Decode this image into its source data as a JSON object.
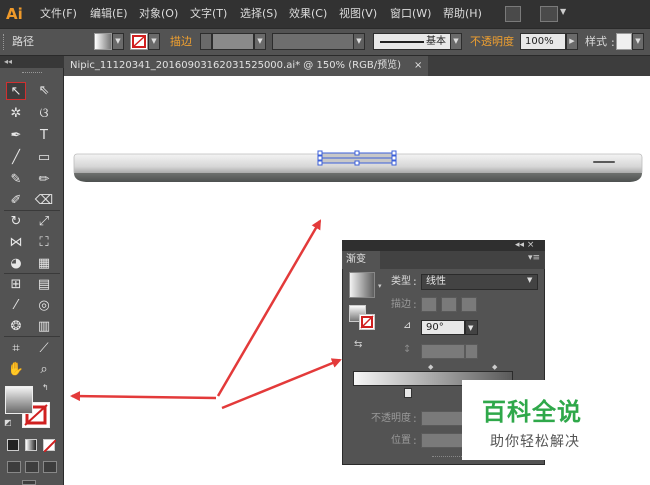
{
  "app": {
    "logo": "Ai"
  },
  "menu": {
    "items": [
      "文件(F)",
      "编辑(E)",
      "对象(O)",
      "文字(T)",
      "选择(S)",
      "效果(C)",
      "视图(V)",
      "窗口(W)",
      "帮助(H)"
    ]
  },
  "control_bar": {
    "object_type": "路径",
    "stroke_label": "描边",
    "stroke_style": "基本",
    "opacity_label": "不透明度",
    "opacity_value": "100%",
    "style_label": "样式"
  },
  "tools_panel": {
    "header": "◂◂"
  },
  "document_tab": {
    "title": "Nipic_11120341_20160903162031525000.ai* @ 150% (RGB/预览)",
    "close": "×"
  },
  "gradient_panel": {
    "top_controls": "◂◂ ×",
    "tab": "渐变",
    "menu_icon": "▾≡",
    "type_label": "类型",
    "type_value": "线性",
    "stroke_label": "描边",
    "angle_value": "90°",
    "opacity_label": "不透明度",
    "position_label": "位置"
  },
  "watermark": {
    "title": "百科全说",
    "subtitle": "助你轻松解决"
  },
  "colors": {
    "menubar_bg": "#323232",
    "panel_bg": "#535353",
    "accent_orange": "#f09a2a",
    "selection_blue": "#3b5fd9",
    "arrow_red": "#e33a3a",
    "watermark_green": "#2fa84a"
  }
}
